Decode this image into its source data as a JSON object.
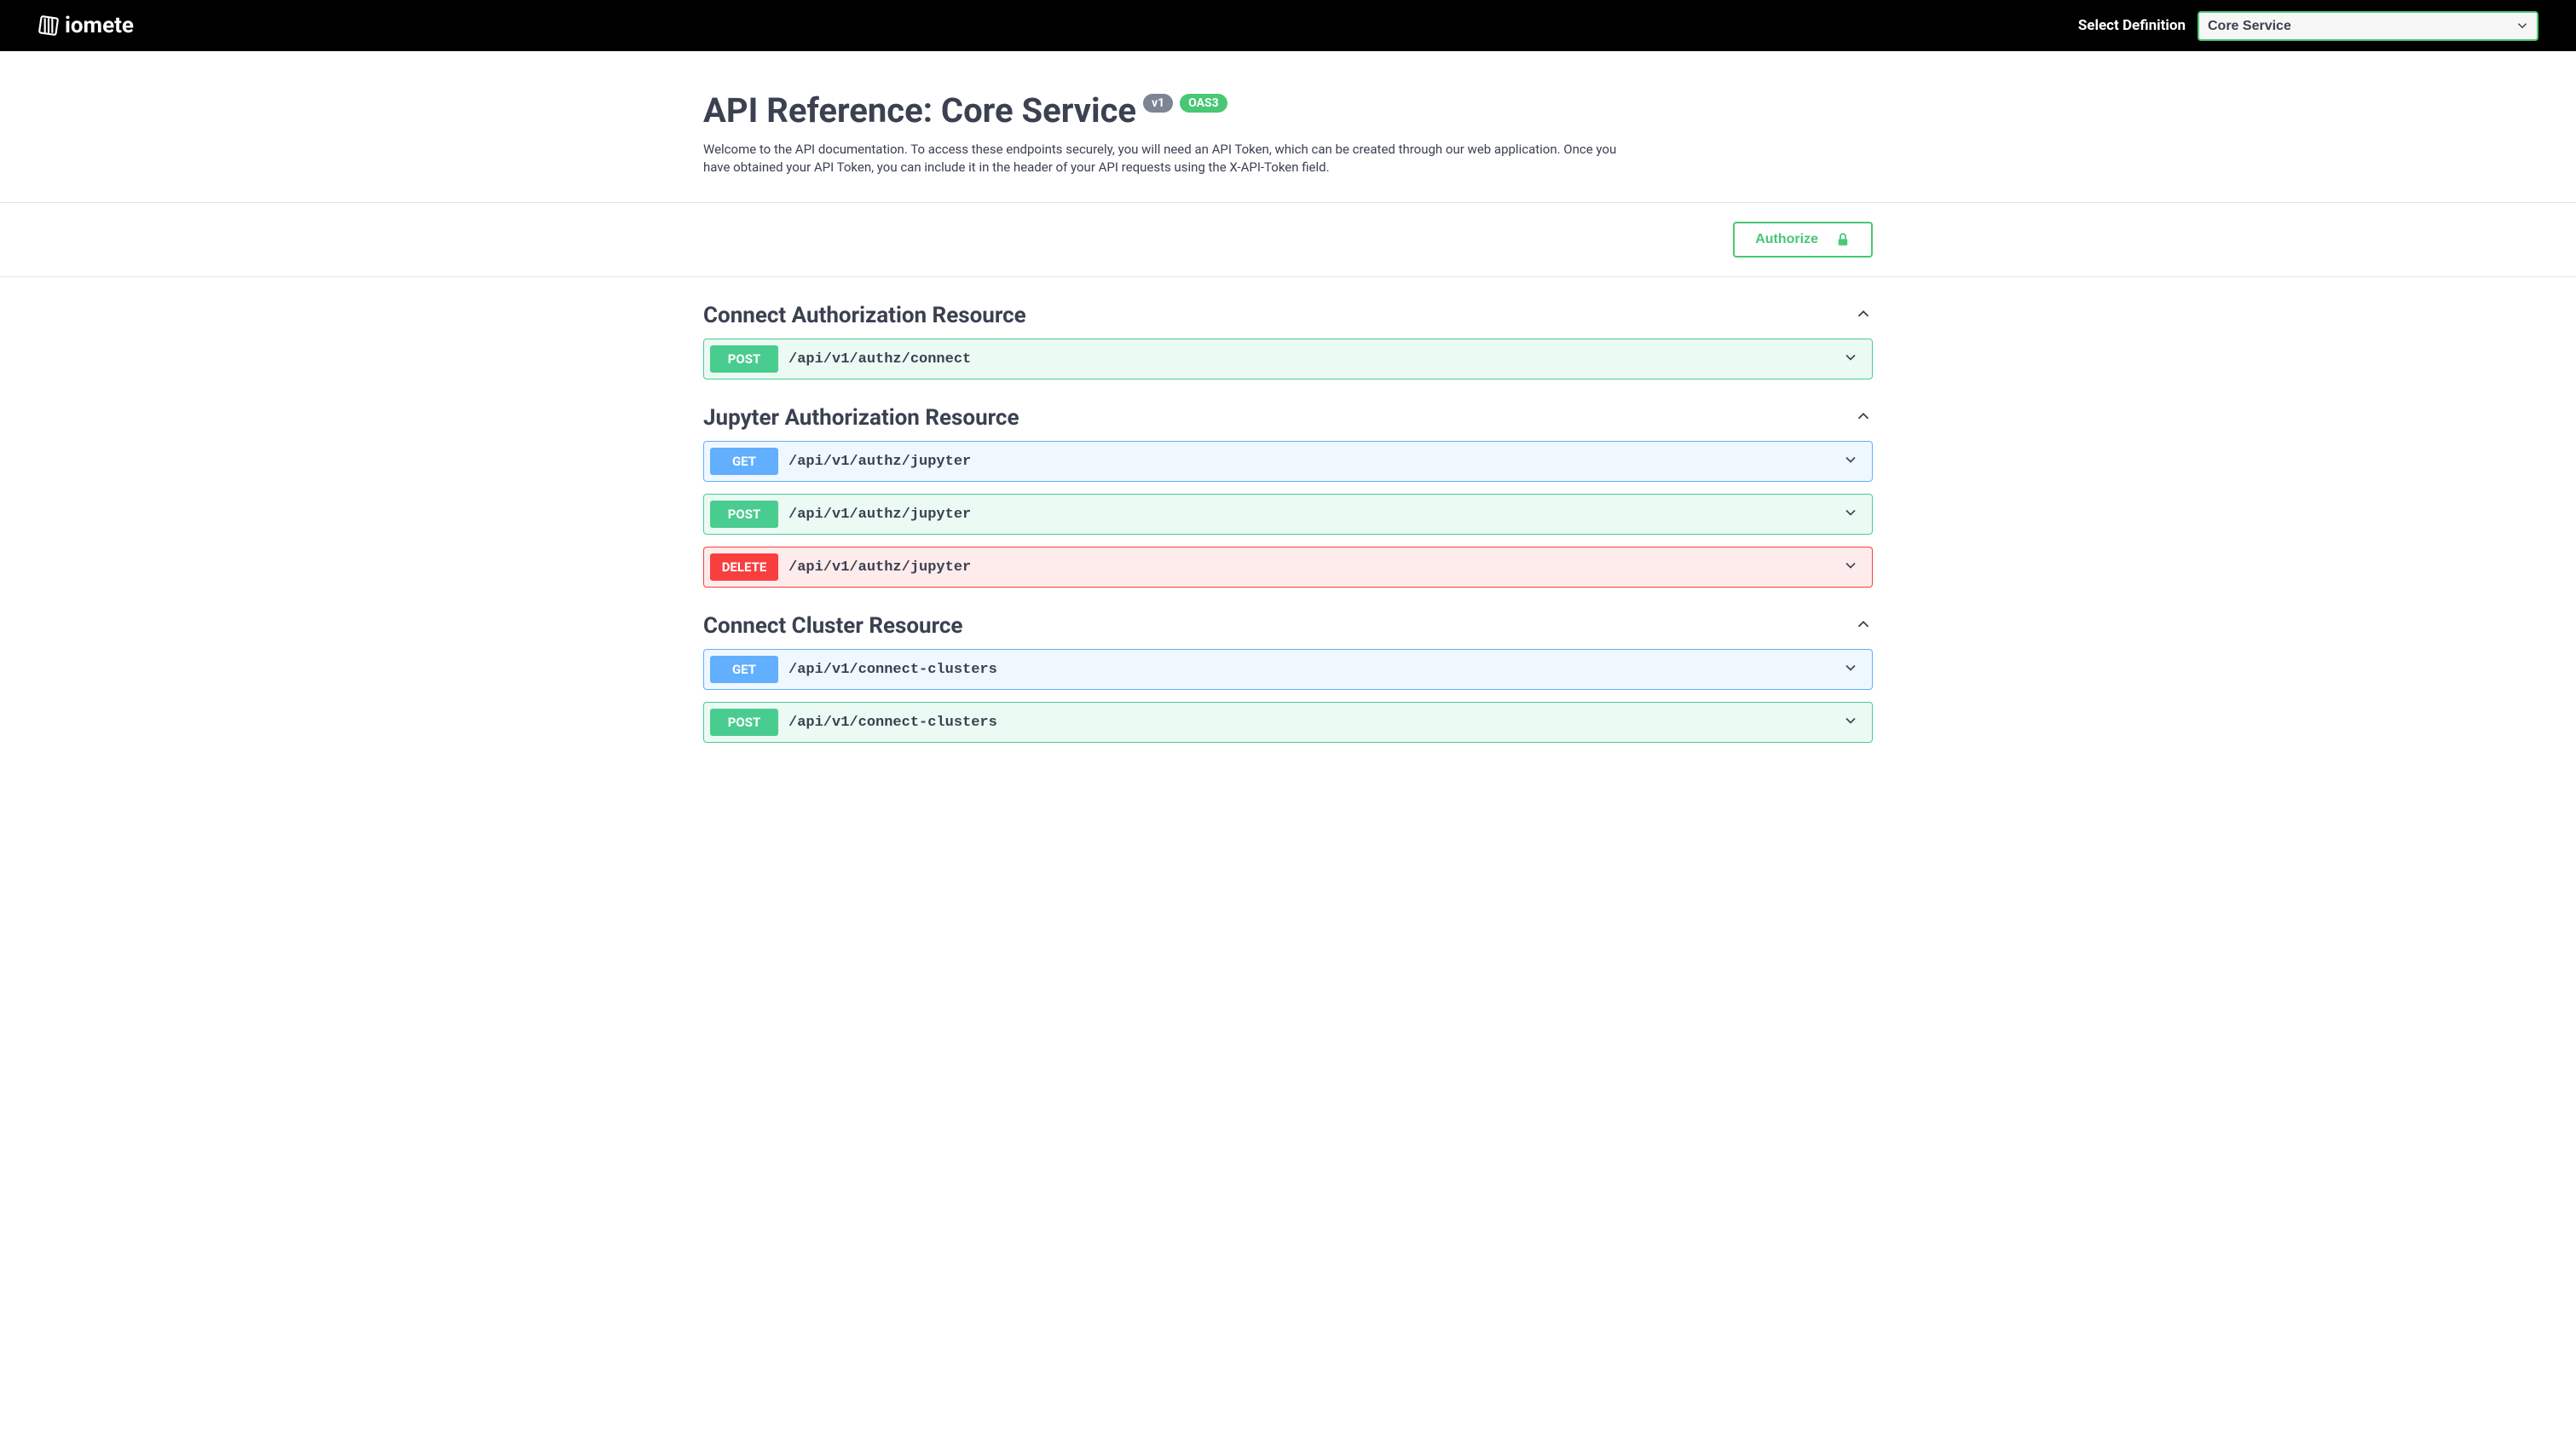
{
  "header": {
    "logo_text": "iomete",
    "select_label": "Select Definition",
    "selected_definition": "Core Service"
  },
  "title": {
    "main": "API Reference: Core Service",
    "version_badge": "v1",
    "oas_badge": "OAS3",
    "description": "Welcome to the API documentation. To access these endpoints securely, you will need an API Token, which can be created through our web application. Once you have obtained your API Token, you can include it in the header of your API requests using the X-API-Token field."
  },
  "authorize_label": "Authorize",
  "methods": {
    "get": "GET",
    "post": "POST",
    "delete": "DELETE"
  },
  "sections": [
    {
      "title": "Connect Authorization Resource",
      "endpoints": [
        {
          "method": "post",
          "path": "/api/v1/authz/connect"
        }
      ]
    },
    {
      "title": "Jupyter Authorization Resource",
      "endpoints": [
        {
          "method": "get",
          "path": "/api/v1/authz/jupyter"
        },
        {
          "method": "post",
          "path": "/api/v1/authz/jupyter"
        },
        {
          "method": "delete",
          "path": "/api/v1/authz/jupyter"
        }
      ]
    },
    {
      "title": "Connect Cluster Resource",
      "endpoints": [
        {
          "method": "get",
          "path": "/api/v1/connect-clusters"
        },
        {
          "method": "post",
          "path": "/api/v1/connect-clusters"
        }
      ]
    }
  ]
}
